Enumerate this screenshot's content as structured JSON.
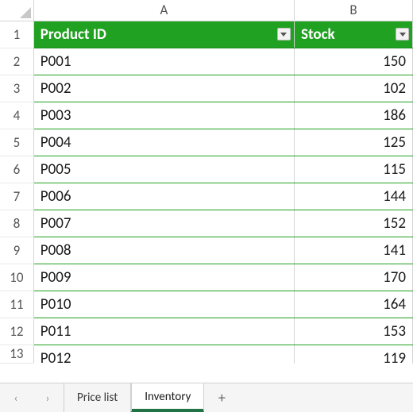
{
  "colors": {
    "table_header_bg": "#21a121",
    "table_header_fg": "#ffffff",
    "row_border": "#21a121",
    "excel_accent": "#217346"
  },
  "columns": [
    "A",
    "B"
  ],
  "header": {
    "col_a": "Product ID",
    "col_b": "Stock"
  },
  "rows": [
    {
      "n": 2,
      "id": "P001",
      "stock": 150
    },
    {
      "n": 3,
      "id": "P002",
      "stock": 102
    },
    {
      "n": 4,
      "id": "P003",
      "stock": 186
    },
    {
      "n": 5,
      "id": "P004",
      "stock": 125
    },
    {
      "n": 6,
      "id": "P005",
      "stock": 115
    },
    {
      "n": 7,
      "id": "P006",
      "stock": 144
    },
    {
      "n": 8,
      "id": "P007",
      "stock": 152
    },
    {
      "n": 9,
      "id": "P008",
      "stock": 141
    },
    {
      "n": 10,
      "id": "P009",
      "stock": 170
    },
    {
      "n": 11,
      "id": "P010",
      "stock": 164
    },
    {
      "n": 12,
      "id": "P011",
      "stock": 153
    }
  ],
  "cut_row": {
    "n": 13,
    "id": "P012",
    "stock": 119
  },
  "tabs": {
    "nav": {
      "prev": "‹",
      "next": "›"
    },
    "items": [
      {
        "label": "Price list",
        "active": false
      },
      {
        "label": "Inventory",
        "active": true
      }
    ],
    "add_label": "+"
  }
}
